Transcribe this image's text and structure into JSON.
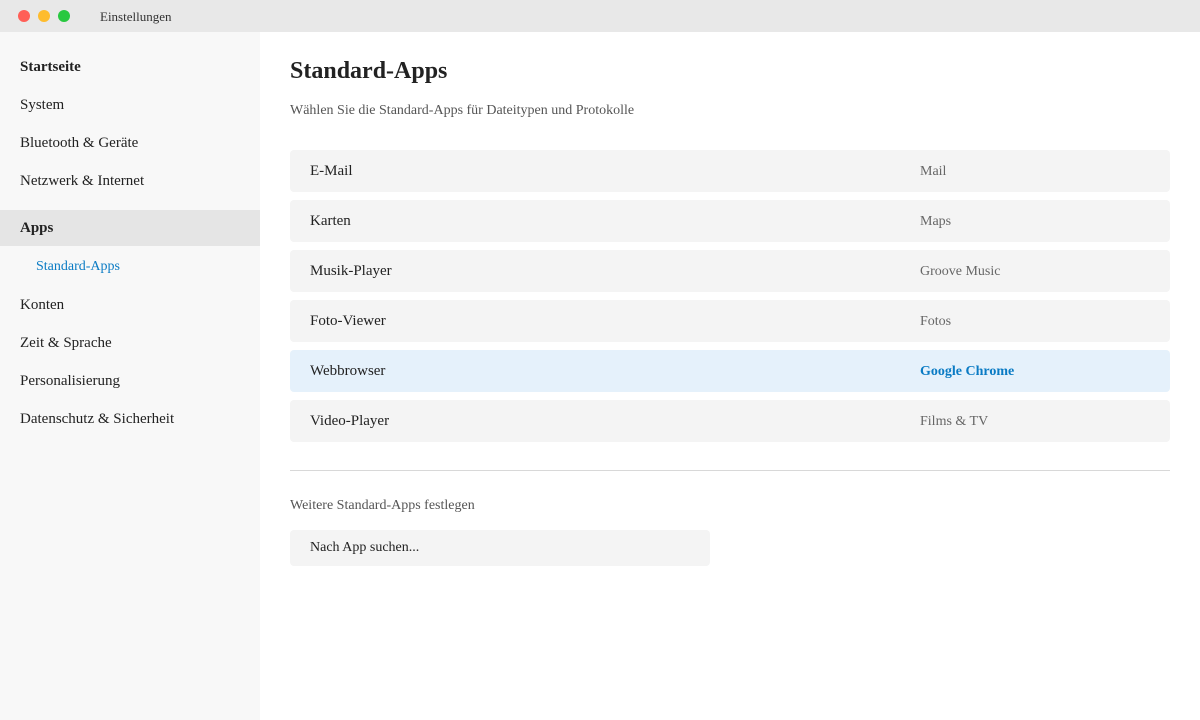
{
  "window": {
    "title": "Einstellungen"
  },
  "sidebar": {
    "items": [
      {
        "label": "Startseite"
      },
      {
        "label": "System"
      },
      {
        "label": "Bluetooth & Geräte"
      },
      {
        "label": "Netzwerk & Internet"
      },
      {
        "label": "Apps"
      },
      {
        "label": "Standard-Apps"
      },
      {
        "label": "Konten"
      },
      {
        "label": "Zeit & Sprache"
      },
      {
        "label": "Personalisierung"
      },
      {
        "label": "Datenschutz & Sicherheit"
      }
    ]
  },
  "main": {
    "title": "Standard-Apps",
    "subtitle": "Wählen Sie die Standard-Apps für Dateitypen und Protokolle",
    "rows": [
      {
        "label": "E-Mail",
        "value": "Mail"
      },
      {
        "label": "Karten",
        "value": "Maps"
      },
      {
        "label": "Musik-Player",
        "value": "Groove Music"
      },
      {
        "label": "Foto-Viewer",
        "value": "Fotos"
      },
      {
        "label": "Webbrowser",
        "value": "Google Chrome"
      },
      {
        "label": "Video-Player",
        "value": "Films & TV"
      }
    ],
    "more_label": "Weitere Standard-Apps festlegen",
    "search": {
      "placeholder": "Nach App suchen...",
      "value": ""
    }
  },
  "colors": {
    "accent": "#0a7bc4",
    "highlight_row": "#e5f1fb",
    "sidebar_bg": "#f8f8f8",
    "titlebar_bg": "#e8e8e8"
  }
}
